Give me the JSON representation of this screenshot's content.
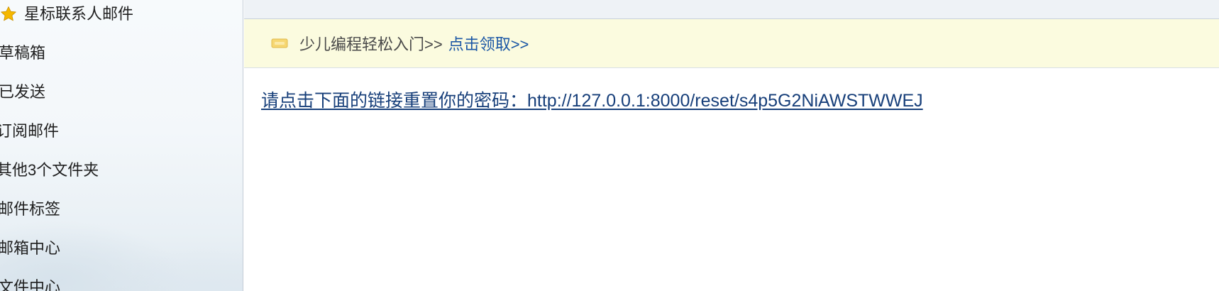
{
  "sidebar": {
    "items": [
      {
        "label": "星标联系人邮件",
        "icon": "star-icon",
        "icon_color": "#f5b800"
      },
      {
        "label": "草稿箱"
      },
      {
        "label": "已发送"
      },
      {
        "label": "订阅邮件"
      },
      {
        "label": "其他3个文件夹"
      },
      {
        "label": "邮件标签"
      },
      {
        "label": "邮箱中心"
      },
      {
        "label": "文件中心"
      }
    ]
  },
  "promo": {
    "icon": "promo-icon",
    "text": "少儿编程轻松入门>>",
    "link_label": "点击领取>>",
    "background": "#fbfbdf",
    "link_color": "#1b57a5"
  },
  "mail": {
    "reset_text": "请点击下面的链接重置你的密码：http://127.0.0.1:8000/reset/s4p5G2NiAWSTWWEJ",
    "link_color": "#173f7a"
  }
}
